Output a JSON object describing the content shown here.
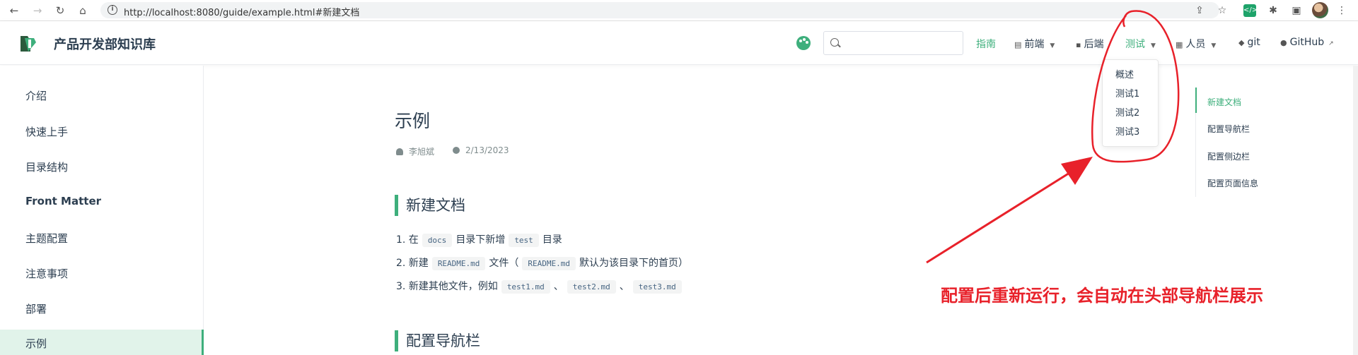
{
  "browser": {
    "url": "http://localhost:8080/guide/example.html#新建文档"
  },
  "site": {
    "title": "产品开发部知识库"
  },
  "navbar": {
    "items": [
      {
        "label": "指南",
        "active": true
      },
      {
        "label": "前端",
        "icon": "document-icon",
        "has_dropdown": true
      },
      {
        "label": "后端",
        "icon": "code-icon"
      },
      {
        "label": "测试",
        "has_dropdown": true
      },
      {
        "label": "人员",
        "icon": "grid-icon",
        "has_dropdown": true
      },
      {
        "label": "git",
        "icon": "diamond-icon"
      },
      {
        "label": "GitHub",
        "icon": "github-icon",
        "external": true
      }
    ],
    "dropdown_test": [
      "概述",
      "测试1",
      "测试2",
      "测试3"
    ]
  },
  "sidebar": {
    "items": [
      "介绍",
      "快速上手",
      "目录结构",
      "Front Matter",
      "主题配置",
      "注意事项",
      "部署",
      "示例"
    ],
    "active_index": 7
  },
  "content": {
    "title": "示例",
    "author": "李旭斌",
    "date": "2/13/2023",
    "section1": {
      "heading": "新建文档",
      "list": [
        {
          "prefix": "1. 在",
          "code1": "docs",
          "mid": "目录下新增",
          "code2": "test",
          "suffix": "目录"
        },
        {
          "prefix": "2. 新建",
          "code1": "README.md",
          "mid": "文件（",
          "code2": "README.md",
          "suffix": "默认为该目录下的首页）"
        },
        {
          "prefix": "3. 新建其他文件，例如",
          "code1": "test1.md",
          "sep1": "、",
          "code2": "test2.md",
          "sep2": "、",
          "code3": "test3.md"
        }
      ]
    },
    "section2": {
      "heading": "配置导航栏"
    }
  },
  "toc": {
    "items": [
      "新建文档",
      "配置导航栏",
      "配置侧边栏",
      "配置页面信息"
    ],
    "active_index": 0
  },
  "annotation": {
    "text": "配置后重新运行，会自动在头部导航栏展示",
    "color": "#e8212a"
  },
  "colors": {
    "accent": "#3eaf7c",
    "text": "#2c3e50"
  }
}
